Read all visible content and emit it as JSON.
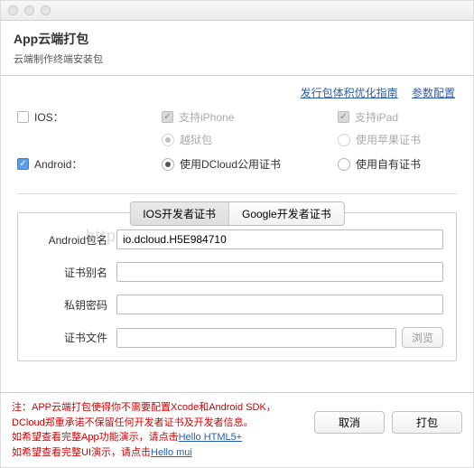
{
  "header": {
    "title": "App云端打包",
    "subtitle": "云端制作终端安装包"
  },
  "links": {
    "optimize": "发行包体积优化指南",
    "params": "参数配置"
  },
  "platforms": {
    "ios_label": "IOS：",
    "ios_iphone": "支持iPhone",
    "ios_ipad": "支持iPad",
    "ios_jailbreak": "越狱包",
    "ios_apple_cert": "使用苹果证书",
    "android_label": "Android：",
    "android_dcloud_cert": "使用DCloud公用证书",
    "android_own_cert": "使用自有证书"
  },
  "tabs": {
    "ios_dev": "IOS开发者证书",
    "google_dev": "Google开发者证书"
  },
  "form": {
    "pkg_label": "Android包名",
    "pkg_value": "io.dcloud.H5E984710",
    "alias_label": "证书别名",
    "alias_value": "",
    "key_label": "私钥密码",
    "key_value": "",
    "file_label": "证书文件",
    "file_value": "",
    "browse": "浏览"
  },
  "watermark": "http://blog.csdn.net/wang1006008051",
  "note": {
    "prefix": "注：",
    "line1": "APP云端打包使得你不需要配置Xcode和Android SDK，",
    "line2": "DCloud郑重承诺不保留任何开发者证书及开发者信息。",
    "line3_a": "如希望查看完整App功能演示，请点击",
    "link1": "Hello HTML5+",
    "line4_a": "如希望查看完整UI演示，请点击",
    "link2": "Hello mui"
  },
  "buttons": {
    "cancel": "取消",
    "pack": "打包"
  }
}
